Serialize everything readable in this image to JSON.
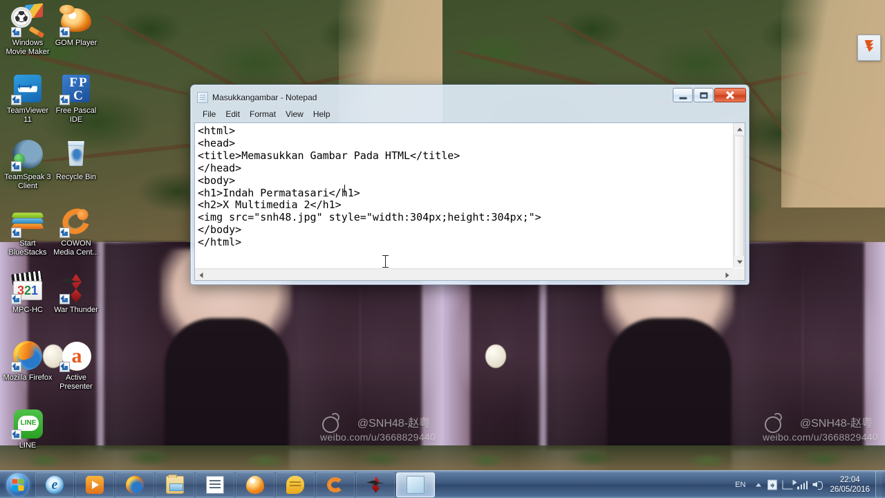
{
  "desktop": {
    "icons": [
      {
        "name": "windows-movie-maker",
        "label": "Windows Movie Maker",
        "art": "wmm",
        "shortcut": true
      },
      {
        "name": "gom-player",
        "label": "GOM Player",
        "art": "gom",
        "shortcut": true
      },
      {
        "name": "teamviewer-11",
        "label": "TeamViewer 11",
        "art": "tv",
        "shortcut": true
      },
      {
        "name": "free-pascal-ide",
        "label": "Free Pascal IDE",
        "art": "fpc",
        "shortcut": true
      },
      {
        "name": "teamspeak-3-client",
        "label": "TeamSpeak 3 Client",
        "art": "ts",
        "shortcut": true
      },
      {
        "name": "recycle-bin",
        "label": "Recycle Bin",
        "art": "bin",
        "shortcut": false
      },
      {
        "name": "start-bluestacks",
        "label": "Start BlueStacks",
        "art": "bs",
        "shortcut": true
      },
      {
        "name": "cowon-media-center",
        "label": "COWON Media Cent...",
        "art": "cowon",
        "shortcut": true
      },
      {
        "name": "mpc-hc",
        "label": "MPC-HC",
        "art": "mpc",
        "shortcut": true
      },
      {
        "name": "war-thunder",
        "label": "War Thunder",
        "art": "wt",
        "shortcut": true
      },
      {
        "name": "mozilla-firefox",
        "label": "Mozilla Firefox",
        "art": "ff",
        "shortcut": true
      },
      {
        "name": "active-presenter",
        "label": "Active Presenter",
        "art": "ap",
        "shortcut": true
      },
      {
        "name": "line",
        "label": "LINE",
        "art": "line",
        "shortcut": true
      }
    ],
    "idm_drop_target": {
      "icon": "download-arrows-icon"
    },
    "wallpaper": {
      "watermark_handle": "@SNH48-赵粤",
      "watermark_url": "weibo.com/u/3668829440"
    }
  },
  "notepad": {
    "title": "Masukkangambar - Notepad",
    "icon": "notepad-document-icon",
    "menus": [
      {
        "name": "file",
        "label": "File"
      },
      {
        "name": "edit",
        "label": "Edit"
      },
      {
        "name": "format",
        "label": "Format"
      },
      {
        "name": "view",
        "label": "View"
      },
      {
        "name": "help",
        "label": "Help"
      }
    ],
    "window_buttons": {
      "minimize": "minimize-icon",
      "maximize": "maximize-icon",
      "close": "close-icon"
    },
    "content": "<html>\n<head>\n<title>Memasukkan Gambar Pada HTML</title>\n</head>\n<body>\n<h1>Indah Permatasari</h1>\n<h2>X Multimedia 2</h1>\n<img src=\"snh48.jpg\" style=\"width:304px;height:304px;\">\n</body>\n</html>",
    "scrollbars": {
      "vertical": {
        "up": "scroll-up-arrow",
        "down": "scroll-down-arrow"
      },
      "horizontal": {
        "left": "scroll-left-arrow",
        "right": "scroll-right-arrow"
      }
    }
  },
  "taskbar": {
    "start": {
      "name": "start-orb",
      "label": "Start"
    },
    "buttons": [
      {
        "name": "internet-explorer",
        "art": "ie",
        "active": false
      },
      {
        "name": "windows-media-player",
        "art": "wmp",
        "active": false
      },
      {
        "name": "mozilla-firefox",
        "art": "ff",
        "active": false
      },
      {
        "name": "windows-explorer",
        "art": "explorer",
        "active": false
      },
      {
        "name": "text-document",
        "art": "notepaddoc",
        "active": false
      },
      {
        "name": "gom-player",
        "art": "gom",
        "active": false
      },
      {
        "name": "chat-app",
        "art": "chat",
        "active": false
      },
      {
        "name": "cowon-media-center",
        "art": "cowon",
        "active": false
      },
      {
        "name": "war-thunder",
        "art": "wt",
        "active": false
      },
      {
        "name": "notepad",
        "art": "notepadapp",
        "active": true
      }
    ],
    "tray": {
      "language": "EN",
      "expand": "show-hidden-icons-chevron",
      "icons": [
        {
          "name": "action-center-icon",
          "art": "action"
        },
        {
          "name": "network-flag-icon",
          "art": "net"
        },
        {
          "name": "signal-bars-icon",
          "art": "bars"
        },
        {
          "name": "volume-icon",
          "art": "vol"
        }
      ],
      "clock": {
        "time": "22:04",
        "date": "26/05/2016"
      },
      "show_desktop": "show-desktop-button"
    }
  }
}
